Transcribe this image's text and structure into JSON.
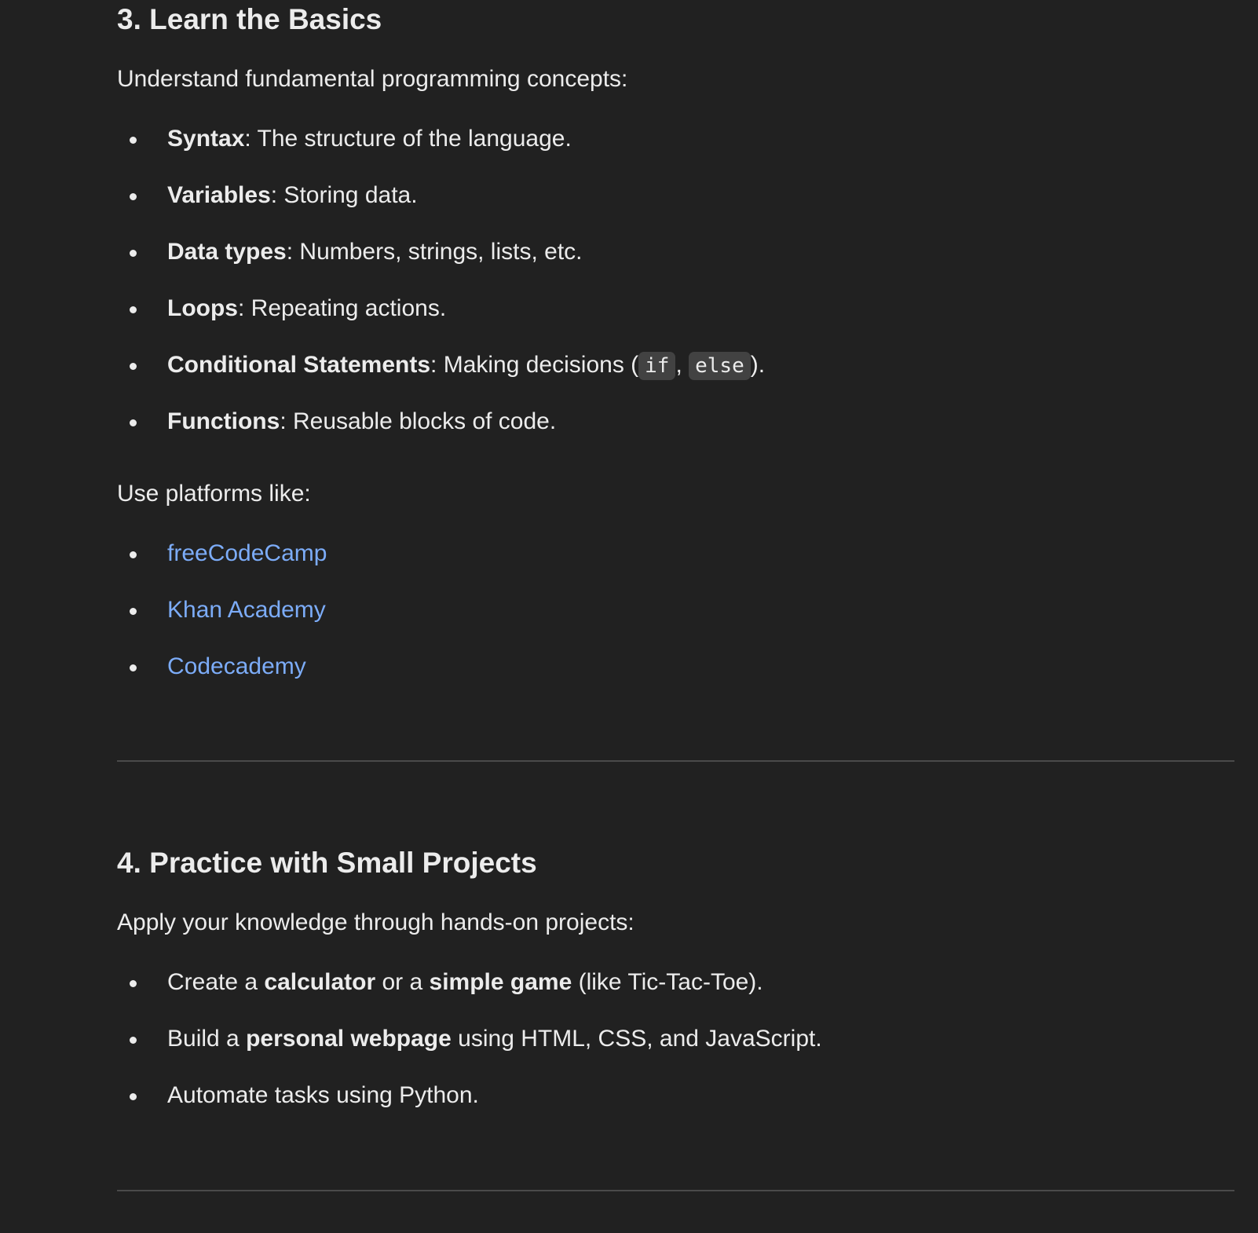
{
  "section3": {
    "heading": "3. Learn the Basics",
    "intro": "Understand fundamental programming concepts:",
    "concepts": [
      {
        "term": "Syntax",
        "desc": ": The structure of the language."
      },
      {
        "term": "Variables",
        "desc": ": Storing data."
      },
      {
        "term": "Data types",
        "desc": ": Numbers, strings, lists, etc."
      },
      {
        "term": "Loops",
        "desc": ": Repeating actions."
      },
      {
        "term": "Conditional Statements",
        "desc": ": Making decisions (",
        "code1": "if",
        "sep": ", ",
        "code2": "else",
        "end": ")."
      },
      {
        "term": "Functions",
        "desc": ": Reusable blocks of code."
      }
    ],
    "platforms_intro": "Use platforms like:",
    "platforms": [
      "freeCodeCamp",
      "Khan Academy",
      "Codecademy"
    ]
  },
  "section4": {
    "heading": "4. Practice with Small Projects",
    "intro": "Apply your knowledge through hands-on projects:",
    "items": [
      {
        "a": "Create a ",
        "b1": "calculator",
        "c": " or a ",
        "b2": "simple game",
        "d": " (like Tic-Tac-Toe)."
      },
      {
        "a": "Build a ",
        "b1": "personal webpage",
        "c": " using HTML, CSS, and JavaScript."
      },
      {
        "a": "Automate tasks using Python."
      }
    ]
  },
  "colors": {
    "background": "#212121",
    "text": "#ececec",
    "link": "#7cacf8"
  }
}
